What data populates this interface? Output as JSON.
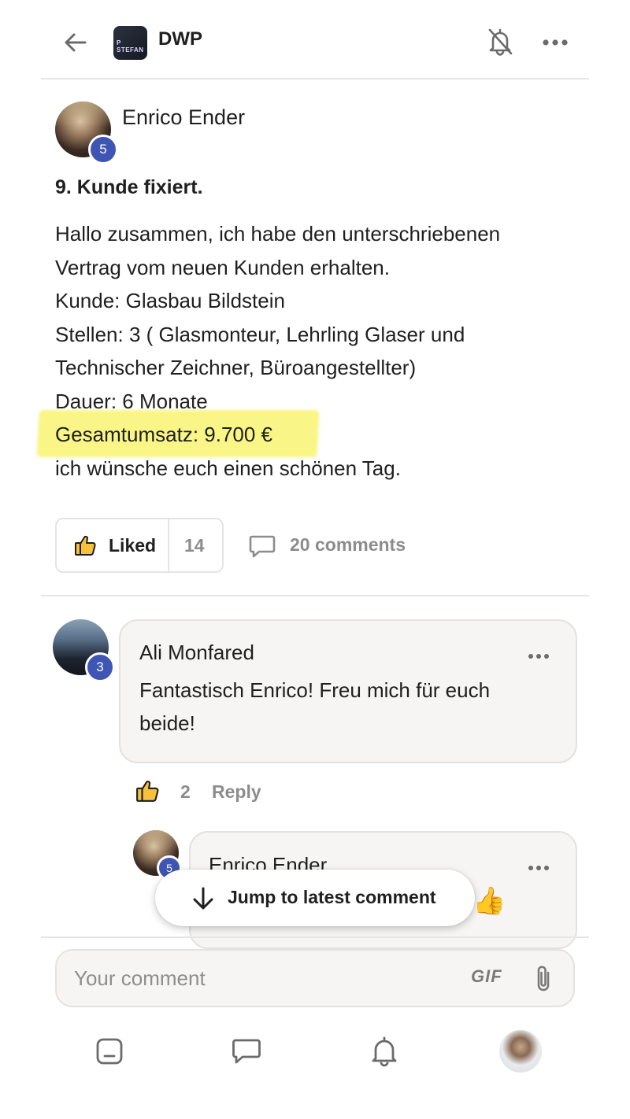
{
  "header": {
    "back_icon": "arrow-left-icon",
    "group_logo_text": "P STEFAN",
    "group_name": "DWP",
    "notification_icon": "bell-off-icon",
    "more_icon": "more-horizontal-icon"
  },
  "post": {
    "author": "Enrico Ender",
    "author_level": "5",
    "title": "9. Kunde fixiert.",
    "body_lines": [
      "Hallo zusammen, ich habe den unterschriebenen",
      "Vertrag vom neuen Kunden erhalten.",
      "Kunde: Glasbau Bildstein",
      "Stellen: 3 ( Glasmonteur, Lehrling Glaser und",
      "Technischer Zeichner, Büroangestellter)",
      "Dauer: 6 Monate",
      "Gesamtumsatz: 9.700 €",
      "ich wünsche euch einen schönen Tag."
    ],
    "like_label": "Liked",
    "like_count": "14",
    "comments_label": "20 comments",
    "highlight_color": "#f9f471"
  },
  "comments": [
    {
      "author": "Ali Monfared",
      "author_level": "3",
      "text_lines": [
        "Fantastisch Enrico! Freu mich für euch",
        "beide!"
      ],
      "like_count": "2",
      "reply_label": "Reply"
    },
    {
      "author": "Enrico Ender",
      "author_level": "5",
      "emoji": "👍"
    }
  ],
  "jump_button": {
    "label": "Jump to latest comment",
    "icon": "arrow-down-icon"
  },
  "composer": {
    "placeholder": "Your comment",
    "gif_label": "GIF",
    "attach_icon": "paperclip-icon"
  },
  "nav": {
    "items": [
      "home-icon",
      "chat-icon",
      "bell-icon",
      "profile-avatar"
    ]
  },
  "colors": {
    "badge": "#3f55b3",
    "muted": "#8c8c8c",
    "bubble": "#f6f5f4"
  }
}
